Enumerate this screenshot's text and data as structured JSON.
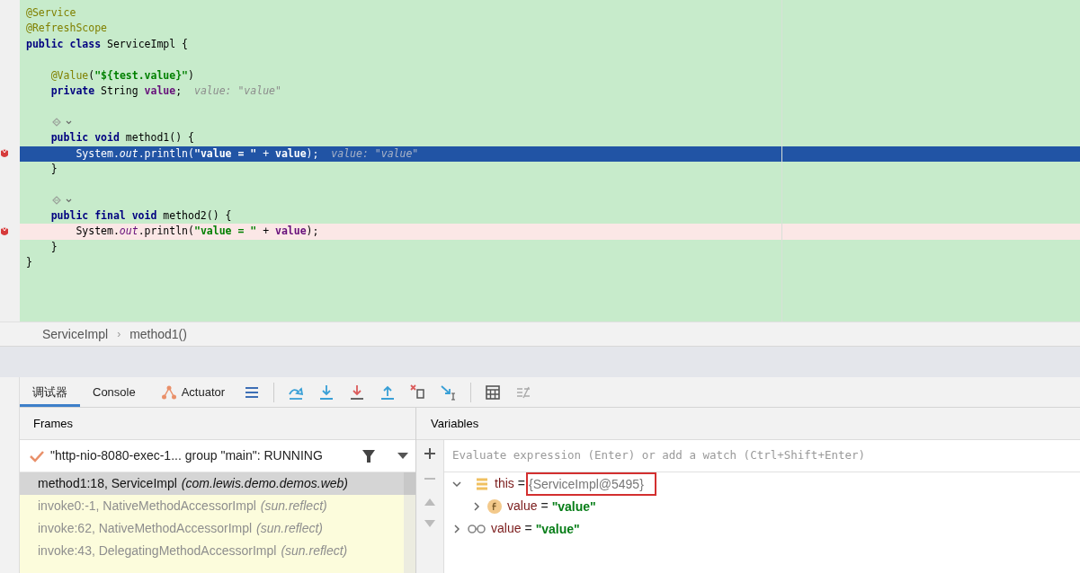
{
  "editor": {
    "lines": [
      {
        "kind": "code",
        "breakpoint": false,
        "current": false,
        "tokens": [
          {
            "kind": "annotation",
            "text": "@Service"
          }
        ]
      },
      {
        "kind": "code",
        "breakpoint": false,
        "current": false,
        "tokens": [
          {
            "kind": "annotation",
            "text": "@RefreshScope"
          }
        ]
      },
      {
        "kind": "code",
        "breakpoint": false,
        "current": false,
        "tokens": [
          {
            "kind": "keyword",
            "text": "public class "
          },
          {
            "kind": "plain",
            "text": "ServiceImpl {"
          }
        ]
      },
      {
        "kind": "blank",
        "breakpoint": false,
        "current": false
      },
      {
        "kind": "code",
        "breakpoint": false,
        "current": false,
        "tokens": [
          {
            "kind": "annotation",
            "text": "    @Value"
          },
          {
            "kind": "plain",
            "text": "("
          },
          {
            "kind": "string",
            "text": "\"${test.value}\""
          },
          {
            "kind": "plain",
            "text": ")"
          }
        ]
      },
      {
        "kind": "code",
        "breakpoint": false,
        "current": false,
        "tokens": [
          {
            "kind": "keyword",
            "text": "    private "
          },
          {
            "kind": "plain",
            "text": "String "
          },
          {
            "kind": "field",
            "text": "value"
          },
          {
            "kind": "plain",
            "text": ";"
          },
          {
            "kind": "hint",
            "text": "value: \"value\""
          }
        ]
      },
      {
        "kind": "blank",
        "breakpoint": false,
        "current": false
      },
      {
        "kind": "lens",
        "breakpoint": false,
        "current": false
      },
      {
        "kind": "code",
        "breakpoint": false,
        "current": false,
        "tokens": [
          {
            "kind": "keyword",
            "text": "    public void "
          },
          {
            "kind": "plain",
            "text": "method1() {"
          }
        ]
      },
      {
        "kind": "code",
        "breakpoint": true,
        "current": true,
        "tokens": [
          {
            "kind": "plain",
            "text": "        System."
          },
          {
            "kind": "static",
            "text": "out"
          },
          {
            "kind": "plain",
            "text": ".println("
          },
          {
            "kind": "string",
            "text": "\"value = \""
          },
          {
            "kind": "plain",
            "text": " + "
          },
          {
            "kind": "field",
            "text": "value"
          },
          {
            "kind": "plain",
            "text": ");"
          },
          {
            "kind": "hint",
            "text": "value: \"value\""
          }
        ]
      },
      {
        "kind": "code",
        "breakpoint": false,
        "current": false,
        "tokens": [
          {
            "kind": "plain",
            "text": "    }"
          }
        ]
      },
      {
        "kind": "blank",
        "breakpoint": false,
        "current": false
      },
      {
        "kind": "lens",
        "breakpoint": false,
        "current": false
      },
      {
        "kind": "code",
        "breakpoint": false,
        "current": false,
        "tokens": [
          {
            "kind": "keyword",
            "text": "    public final void "
          },
          {
            "kind": "plain",
            "text": "method2() {"
          }
        ]
      },
      {
        "kind": "code",
        "breakpoint": true,
        "current": false,
        "tokens": [
          {
            "kind": "plain",
            "text": "        System."
          },
          {
            "kind": "static",
            "text": "out"
          },
          {
            "kind": "plain",
            "text": ".println("
          },
          {
            "kind": "string",
            "text": "\"value = \""
          },
          {
            "kind": "plain",
            "text": " + "
          },
          {
            "kind": "field",
            "text": "value"
          },
          {
            "kind": "plain",
            "text": ");"
          }
        ]
      },
      {
        "kind": "code",
        "breakpoint": false,
        "current": false,
        "tokens": [
          {
            "kind": "plain",
            "text": "    }"
          }
        ]
      },
      {
        "kind": "code",
        "breakpoint": false,
        "current": false,
        "tokens": [
          {
            "kind": "plain",
            "text": "}"
          }
        ]
      }
    ]
  },
  "breadcrumb": {
    "items": [
      "ServiceImpl",
      "method1()"
    ],
    "separator": "›"
  },
  "debug_tabs": [
    {
      "label": "调试器",
      "selected": true,
      "kind": "plain"
    },
    {
      "label": "Console",
      "selected": false,
      "kind": "plain"
    },
    {
      "label": "Actuator",
      "selected": false,
      "kind": "actuator"
    }
  ],
  "frames": {
    "title": "Frames",
    "thread": "\"http-nio-8080-exec-1... group \"main\": RUNNING",
    "items": [
      {
        "method": "method1:18, ServiceImpl",
        "package": "(com.lewis.demo.demos.web)",
        "selected": true
      },
      {
        "method": "invoke0:-1, NativeMethodAccessorImpl",
        "package": "(sun.reflect)",
        "selected": false
      },
      {
        "method": "invoke:62, NativeMethodAccessorImpl",
        "package": "(sun.reflect)",
        "selected": false
      },
      {
        "method": "invoke:43, DelegatingMethodAccessorImpl",
        "package": "(sun.reflect)",
        "selected": false
      }
    ]
  },
  "variables": {
    "title": "Variables",
    "placeholder": "Evaluate expression (Enter) or add a watch (Ctrl+Shift+Enter)",
    "items": [
      {
        "kind": "object",
        "name": "this",
        "operator": "=",
        "value": "{ServiceImpl@5495}",
        "expanded": true,
        "highlighted": true,
        "children": [
          {
            "kind": "field",
            "name": "value",
            "operator": "=",
            "value": "\"value\"",
            "expanded": false,
            "highlighted": false
          }
        ]
      },
      {
        "kind": "watch",
        "name": "value",
        "operator": "=",
        "value": "\"value\"",
        "expanded": false,
        "highlighted": false
      }
    ]
  }
}
